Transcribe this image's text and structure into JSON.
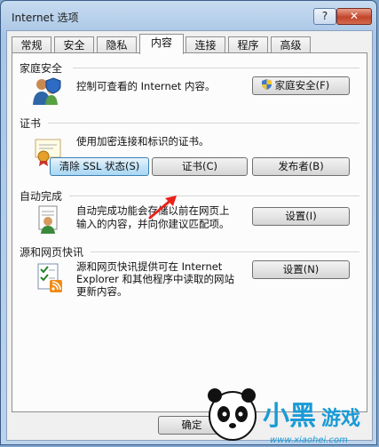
{
  "window": {
    "title": "Internet 选项",
    "help_label": "?",
    "close_label": "✕"
  },
  "tabs": [
    {
      "label": "常规"
    },
    {
      "label": "安全"
    },
    {
      "label": "隐私"
    },
    {
      "label": "内容",
      "active": true
    },
    {
      "label": "连接"
    },
    {
      "label": "程序"
    },
    {
      "label": "高级"
    }
  ],
  "family_safety": {
    "heading": "家庭安全",
    "description": "控制可查看的 Internet 内容。",
    "button_label": "家庭安全(F)"
  },
  "certificates": {
    "heading": "证书",
    "description": "使用加密连接和标识的证书。",
    "clear_ssl_label": "清除 SSL 状态(S)",
    "certificates_label": "证书(C)",
    "publishers_label": "发布者(B)"
  },
  "autocomplete": {
    "heading": "自动完成",
    "description_line1": "自动完成功能会存储以前在网页上",
    "description_line2": "输入的内容，并向你建议匹配项。",
    "settings_label": "设置(I)"
  },
  "feeds": {
    "heading": "源和网页快讯",
    "description_line1": "源和网页快讯提供可在 Internet",
    "description_line2": "Explorer 和其他程序中读取的网站",
    "description_line3": "更新内容。",
    "settings_label": "设置(N)"
  },
  "footer": {
    "ok_label": "确定"
  },
  "watermark": {
    "brand": "小黑游戏",
    "url": "www.xiaohei.com"
  },
  "colors": {
    "arrow": "#e8231c",
    "focus_button": "#a9d7f3",
    "window_frame": "#a9c6e6"
  }
}
